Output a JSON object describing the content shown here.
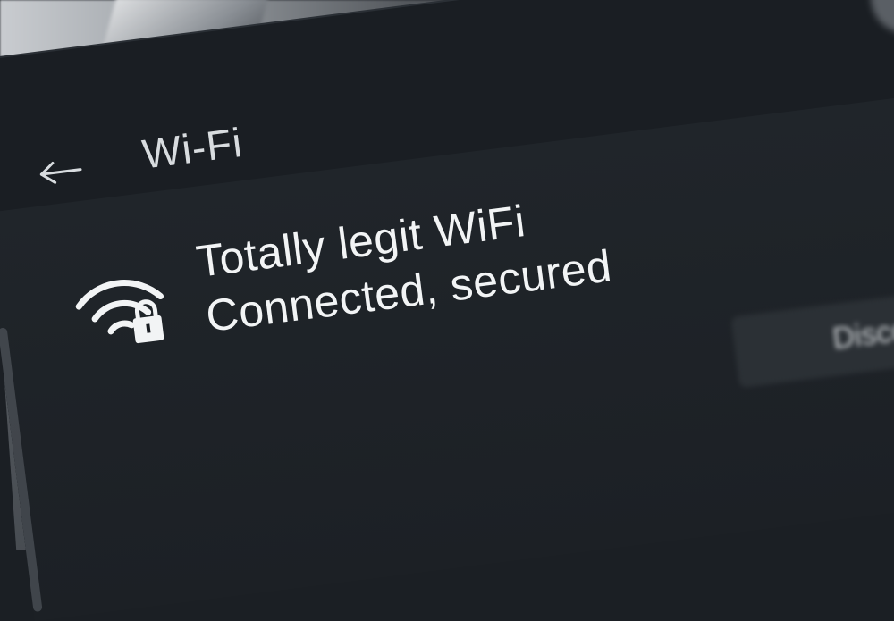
{
  "header": {
    "title": "Wi-Fi"
  },
  "network": {
    "name": "Totally legit WiFi",
    "status": "Connected, secured",
    "action_label": "Disconnect"
  },
  "icons": {
    "back": "back-arrow-icon",
    "wifi": "wifi-secured-icon"
  },
  "colors": {
    "window_bg": "#1a1e23",
    "text": "#f2f4f5",
    "title": "#d8dcdf"
  }
}
